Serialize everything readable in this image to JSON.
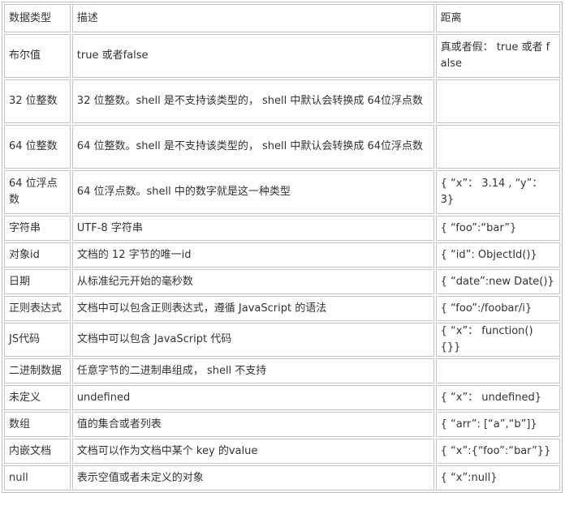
{
  "table": {
    "headers": [
      "数据类型",
      "描述",
      "距离"
    ],
    "rows": [
      [
        "布尔值",
        "true 或者false",
        "真或者假： true 或者 false"
      ],
      [
        "32 位整数",
        "32 位整数。shell 是不支持该类型的， shell 中默认会转换成 64位浮点数",
        ""
      ],
      [
        "64 位整数",
        "64 位整数。shell 是不支持该类型的， shell 中默认会转换成 64位浮点数",
        ""
      ],
      [
        "64 位浮点数",
        "64 位浮点数。shell 中的数字就是这一种类型",
        "{ “x”： 3.14 , “y”： 3}"
      ],
      [
        "字符串",
        "UTF-8 字符串",
        "{ “foo”:“bar”}"
      ],
      [
        "对象id",
        "文档的 12 字节的唯一id",
        "{ “id”: ObjectId()}"
      ],
      [
        "日期",
        "从标准纪元开始的毫秒数",
        "{ “date”:new Date()}"
      ],
      [
        "正则表达式",
        "文档中可以包含正则表达式，遵循 JavaScript 的语法",
        "{ “foo”:/foobar/i}"
      ],
      [
        "JS代码",
        "文档中可以包含 JavaScript 代码",
        "{ “x”： function() {}}"
      ],
      [
        "二进制数据",
        "任意字节的二进制串组成， shell 不支持",
        ""
      ],
      [
        "未定义",
        "undefined",
        "{ “x”： undefined}"
      ],
      [
        "数组",
        "值的集合或者列表",
        "{ “arr”: [“a”,“b”]}"
      ],
      [
        "内嵌文档",
        "文档可以作为文档中某个 key 的value",
        "{ “x”:{“foo”:“bar”}}"
      ],
      [
        "null",
        "表示空值或者未定义的对象",
        "{ “x”:null}"
      ]
    ]
  }
}
